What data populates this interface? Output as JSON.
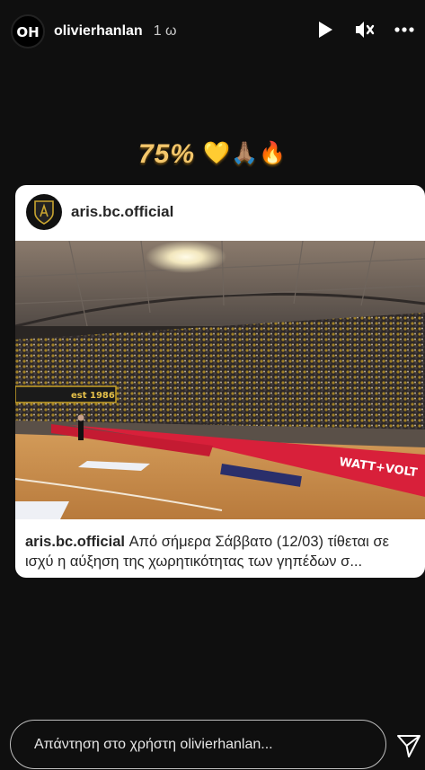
{
  "header": {
    "username": "olivierhanlan",
    "time": "1 ω",
    "icons": [
      "play-icon",
      "mute-icon",
      "more-icon"
    ]
  },
  "caption": {
    "text": "75%",
    "emojis": "💛🙏🏽🔥"
  },
  "post": {
    "account": "aris.bc.official",
    "text_user": "aris.bc.official",
    "text_body": "Από σήμερα Σάββατο (12/03) τίθεται σε ισχύ η αύξηση της χωρητικότητας των γηπέδων σ...",
    "arena_signs": {
      "banner": "est 1986",
      "sponsor": "WATT+VOLT"
    }
  },
  "reply": {
    "placeholder": "Απάντηση στο χρήστη olivierhanlan..."
  },
  "colors": {
    "background": "#0f0f0f",
    "caption_gold": "#f3c66b",
    "card_bg": "#ffffff"
  }
}
